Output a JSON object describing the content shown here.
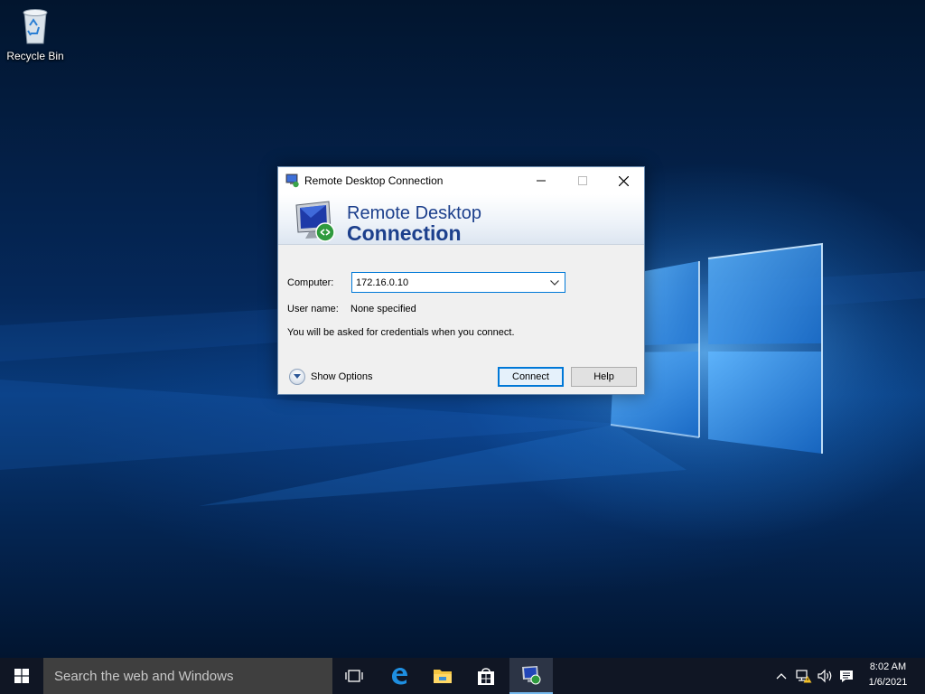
{
  "desktop": {
    "icons": [
      {
        "label": "Recycle Bin",
        "icon": "recycle-bin-icon"
      }
    ]
  },
  "dialog": {
    "title": "Remote Desktop Connection",
    "banner": {
      "line1": "Remote Desktop",
      "line2": "Connection"
    },
    "computer_label": "Computer:",
    "computer_value": "172.16.0.10",
    "username_label": "User name:",
    "username_value": "None specified",
    "credentials_note": "You will be asked for credentials when you connect.",
    "show_options_label": "Show Options",
    "connect_label": "Connect",
    "help_label": "Help",
    "accent_color": "#1c3f8c"
  },
  "taskbar": {
    "search_placeholder": "Search the web and Windows",
    "apps": [
      {
        "name": "task-view-icon"
      },
      {
        "name": "edge-icon"
      },
      {
        "name": "file-explorer-icon"
      },
      {
        "name": "store-icon"
      },
      {
        "name": "remote-desktop-icon",
        "active": true
      }
    ],
    "clock": {
      "time": "8:02 AM",
      "date": "1/6/2021"
    }
  }
}
